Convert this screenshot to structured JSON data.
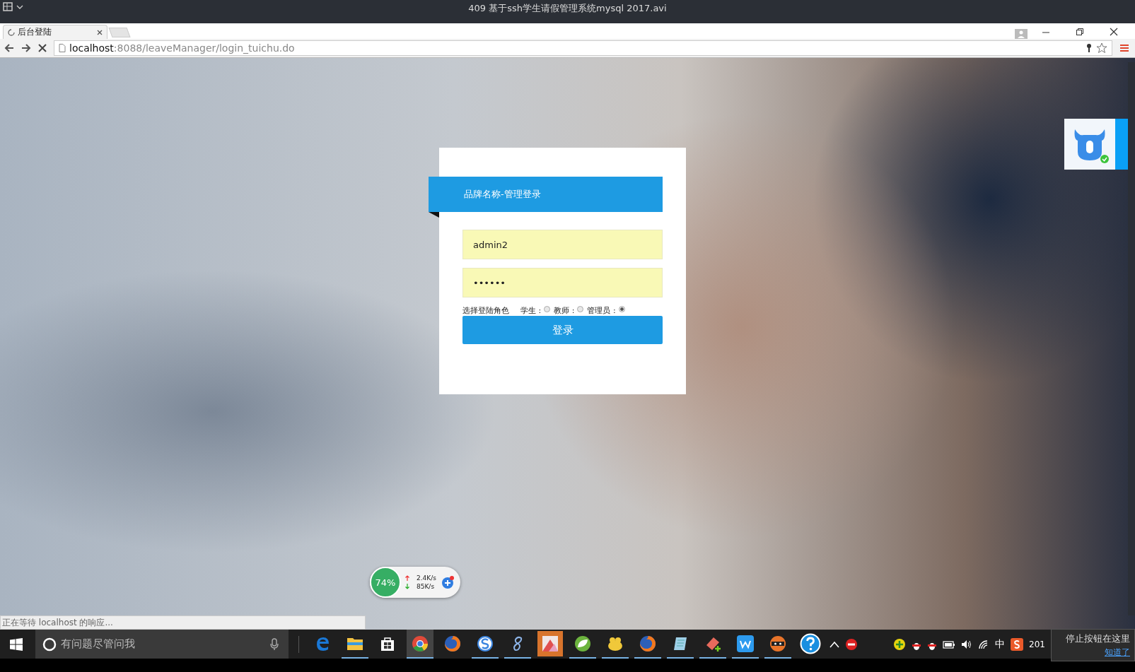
{
  "player": {
    "title": "409 基于ssh学生请假管理系统mysql 2017.avi"
  },
  "browser": {
    "tab": {
      "title": "后台登陆",
      "loading": true
    },
    "address": {
      "host": "localhost",
      "rest": ":8088/leaveManager/login_tuichu.do"
    },
    "status": "正在等待 localhost 的响应..."
  },
  "login": {
    "title": "品牌名称-管理登录",
    "username": "admin2",
    "password": "••••••",
    "role_label": "选择登陆角色",
    "roles": [
      {
        "label": "学生 :",
        "selected": false
      },
      {
        "label": "教师 :",
        "selected": false
      },
      {
        "label": "管理员 :",
        "selected": true
      }
    ],
    "submit": "登录"
  },
  "net_widget": {
    "percent": "74%",
    "upload": "2.4K/s",
    "download": "85K/s"
  },
  "taskbar": {
    "search_placeholder": "有问题尽管问我",
    "apps": [
      {
        "kind": "edge",
        "running": false,
        "active": false
      },
      {
        "kind": "folder",
        "running": true,
        "active": false
      },
      {
        "kind": "store",
        "running": false,
        "active": false
      },
      {
        "kind": "chrome",
        "running": true,
        "active": true
      },
      {
        "kind": "firefox",
        "running": false,
        "active": false
      },
      {
        "kind": "s-circle",
        "running": true,
        "active": false
      },
      {
        "kind": "eight",
        "running": true,
        "active": false
      },
      {
        "kind": "photo",
        "running": false,
        "active": false
      },
      {
        "kind": "leaf",
        "running": true,
        "active": false
      },
      {
        "kind": "duck",
        "running": true,
        "active": false
      },
      {
        "kind": "firefox",
        "running": true,
        "active": false
      },
      {
        "kind": "notepad",
        "running": true,
        "active": false
      },
      {
        "kind": "eraser",
        "running": true,
        "active": false
      },
      {
        "kind": "w",
        "running": true,
        "active": false
      },
      {
        "kind": "ninja",
        "running": true,
        "active": false
      },
      {
        "kind": "help",
        "running": false,
        "active": false
      }
    ],
    "ime": "中",
    "clock": "201",
    "tip": {
      "text": "停止按钮在这里",
      "link": "知道了"
    }
  }
}
